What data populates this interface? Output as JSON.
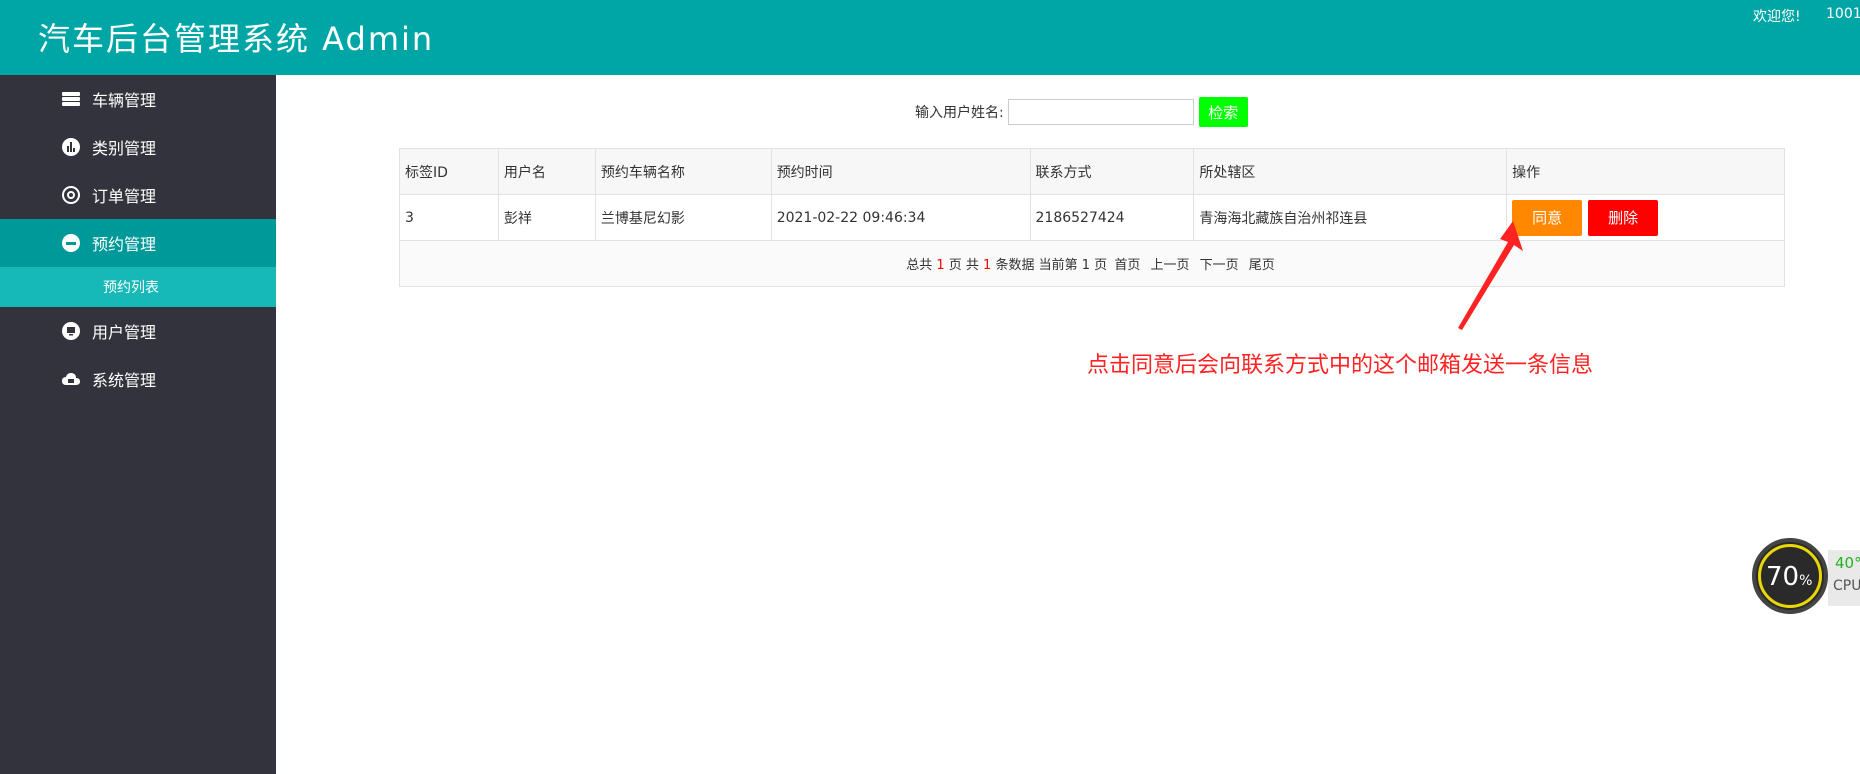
{
  "header": {
    "title": "汽车后台管理系统 Admin",
    "welcome": "欢迎您!",
    "user": "1001"
  },
  "sidebar": {
    "items": [
      {
        "label": "车辆管理",
        "icon": "car-icon"
      },
      {
        "label": "类别管理",
        "icon": "chart-icon"
      },
      {
        "label": "订单管理",
        "icon": "gear-icon"
      },
      {
        "label": "预约管理",
        "icon": "app-icon"
      },
      {
        "label": "用户管理",
        "icon": "monitor-icon"
      },
      {
        "label": "系统管理",
        "icon": "cloud-icon"
      }
    ],
    "sub_items": [
      "预约列表"
    ]
  },
  "search": {
    "label": "输入用户姓名:",
    "value": "",
    "button": "检索"
  },
  "table": {
    "columns": [
      "标签ID",
      "用户名",
      "预约车辆名称",
      "预约时间",
      "联系方式",
      "所处辖区",
      "操作"
    ],
    "rows": [
      {
        "id": "3",
        "username": "彭祥",
        "car": "兰博基尼幻影",
        "time": "2021-02-22 09:46:34",
        "contact": "2186527424",
        "district": "青海海北藏族自治州祁连县"
      }
    ],
    "agree_label": "同意",
    "delete_label": "删除"
  },
  "pager": {
    "t1": "总共",
    "total_pages": "1",
    "t2": "页 共",
    "total_rows": "1",
    "t3": "条数据 当前第",
    "current": "1",
    "t4": "页",
    "first": "首页",
    "prev": "上一页",
    "next": "下一页",
    "last": "尾页"
  },
  "annotation": "点击同意后会向联系方式中的这个邮箱发送一条信息",
  "colors": {
    "header": "#00a6a6",
    "sidebar": "#33333d",
    "active": "#009999",
    "agree": "#ff8800",
    "delete": "#ff0000",
    "search_btn": "#00ff00",
    "annotation": "#ff2222"
  },
  "cpu_widget": {
    "value": "70",
    "unit": "%",
    "temp": "40°",
    "label": "CPU"
  }
}
